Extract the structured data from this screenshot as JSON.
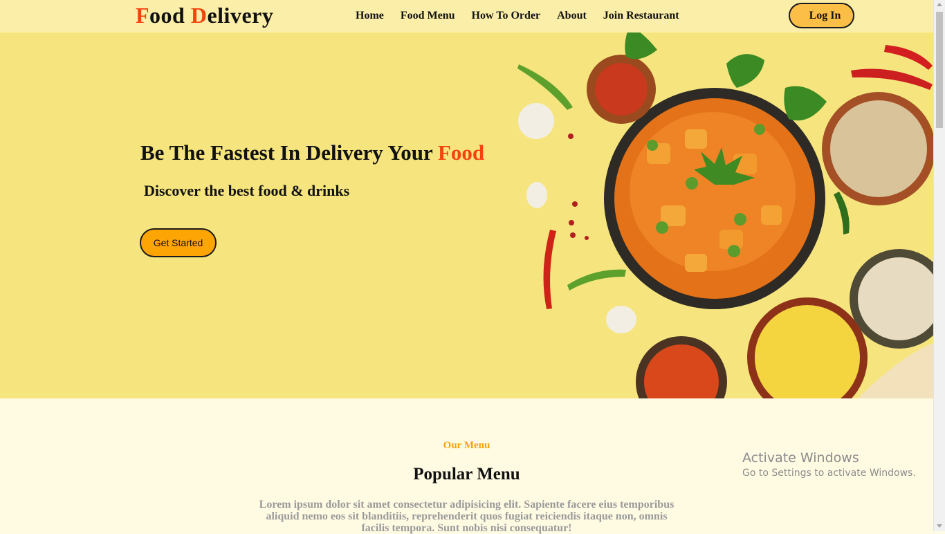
{
  "brand": {
    "first_initial": "F",
    "first_rest": "ood ",
    "second_initial": "D",
    "second_rest": "elivery",
    "accent_color": "#f2450e"
  },
  "nav": {
    "items": [
      "Home",
      "Food Menu",
      "How To Order",
      "About",
      "Join Restaurant"
    ],
    "login": "Log In"
  },
  "hero": {
    "title_main": "Be The Fastest In Delivery Your ",
    "title_accent": "Food",
    "subtitle": "Discover the best food & drinks",
    "cta": "Get Started",
    "image": "food-bowls-spread"
  },
  "menu_section": {
    "tag": "Our Menu",
    "title": "Popular Menu",
    "description": "Lorem ipsum dolor sit amet consectetur adipisicing elit. Sapiente facere eius temporibus aliquid nemo eos sit blanditiis, reprehenderit quos fugiat reiciendis itaque non, omnis facilis tempora. Sunt nobis nisi consequatur!"
  },
  "watermark": {
    "title": "Activate Windows",
    "subtitle": "Go to Settings to activate Windows."
  },
  "colors": {
    "nav_bg": "#fbeea9",
    "hero_bg": "#f6e57e",
    "cta": "#fea506",
    "login": "#fbbf47",
    "tag": "#f5a20b",
    "page_bg": "#fffbe3"
  }
}
